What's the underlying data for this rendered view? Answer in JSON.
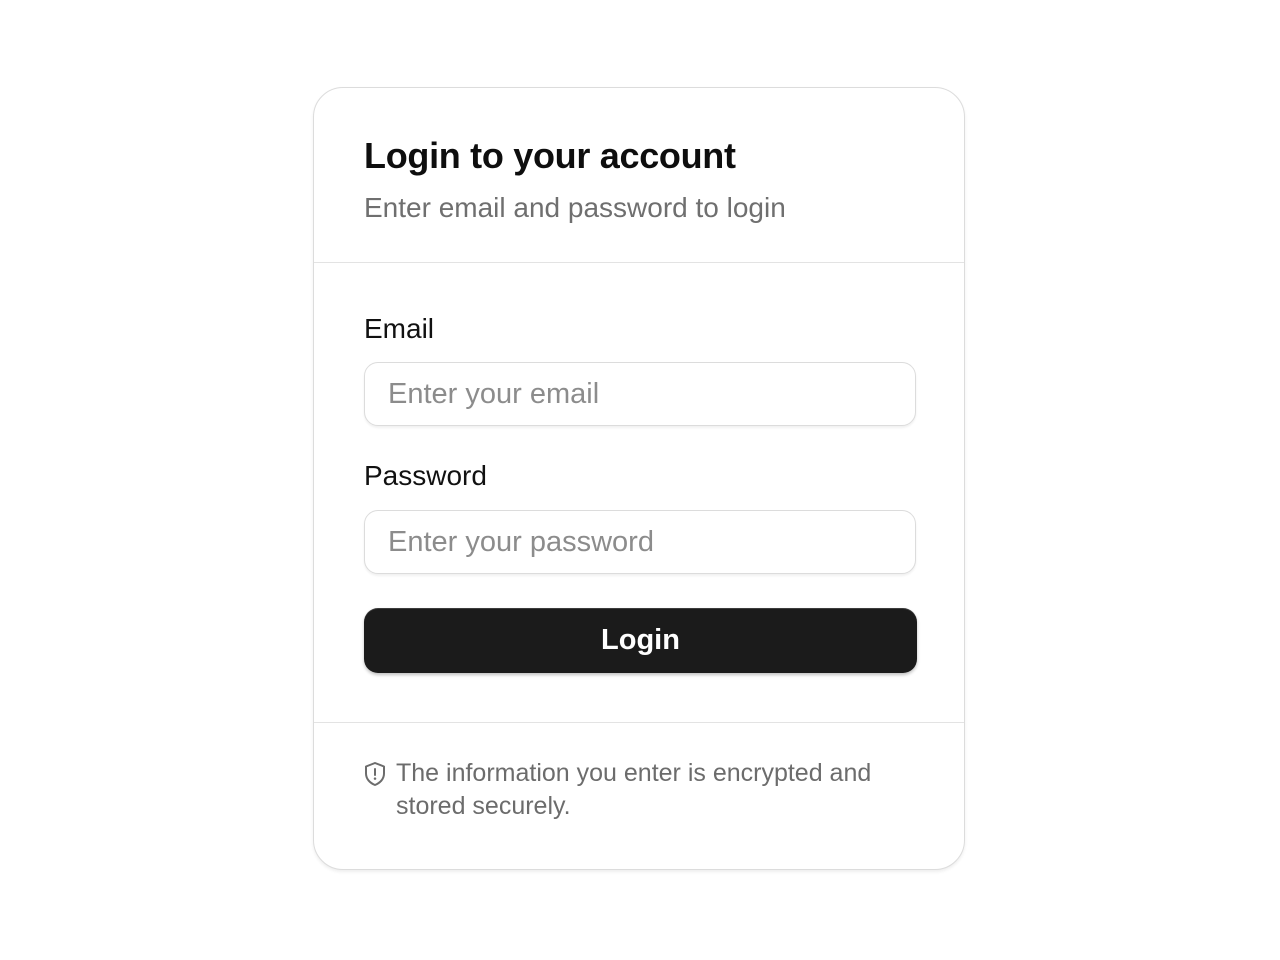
{
  "header": {
    "title": "Login to your account",
    "subtitle": "Enter email and password to login"
  },
  "form": {
    "email": {
      "label": "Email",
      "placeholder": "Enter your email",
      "value": ""
    },
    "password": {
      "label": "Password",
      "placeholder": "Enter your password",
      "value": ""
    },
    "submit_label": "Login"
  },
  "footer": {
    "icon": "shield-alert-icon",
    "note": "The information you enter is encrypted and stored securely."
  },
  "colors": {
    "button_background": "#1b1b1b",
    "button_text": "#ffffff",
    "border": "#dcdcdc",
    "muted_text": "#6f6f6f",
    "placeholder_text": "#8c8c8c"
  }
}
